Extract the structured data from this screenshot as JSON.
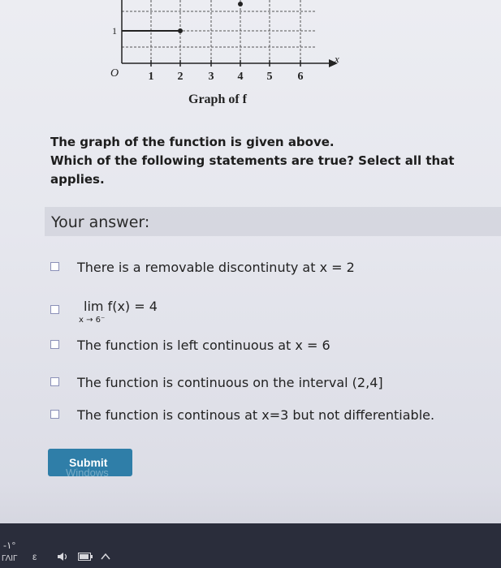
{
  "graph": {
    "caption": "Graph of f",
    "origin_label": "O",
    "x_axis_label": "x",
    "y_tick_label": "1",
    "x_ticks": [
      "1",
      "2",
      "3",
      "4",
      "5",
      "6"
    ]
  },
  "question": {
    "line1": "The graph of the function is given above.",
    "line2": "Which of the following statements are true? Select all that applies."
  },
  "answer_header": "Your answer:",
  "options": [
    {
      "text": "There is a removable discontinuty at x = 2"
    },
    {
      "lim_expr": "lim f(x) = 4",
      "lim_sub": "x → 6⁻"
    },
    {
      "text": "The function is left continuous at x = 6"
    },
    {
      "text": "The function is continuous on the interval (2,4]"
    },
    {
      "text": "The function is continous at x=3 but not differentiable."
    }
  ],
  "submit_label": "Submit",
  "submit_watermark": "Windows",
  "taskbar": {
    "left_top": "-۱°",
    "left_bottom": "ΓΛΙΓ",
    "lang": "ε",
    "volume_icon": "speaker-icon",
    "battery_icon": "battery-icon",
    "chevron_icon": "chevron-up-icon"
  },
  "accent_color": "#2f7ea8"
}
